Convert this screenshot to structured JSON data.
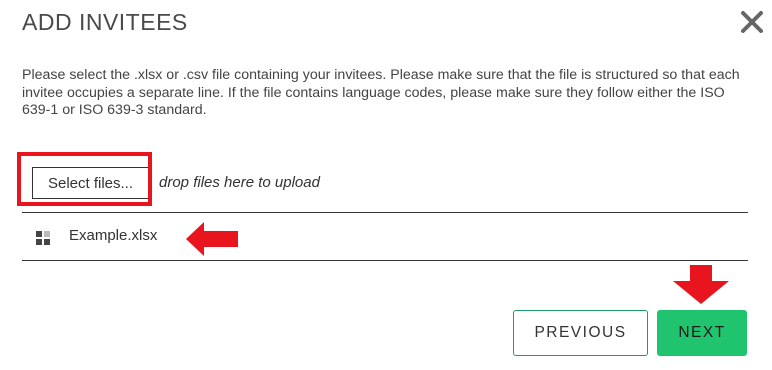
{
  "dialog": {
    "title": "ADD INVITEES",
    "close_icon": "close-icon",
    "description": "Please select the .xlsx or .csv file containing your invitees. Please make sure that the file is structured so that each invitee occupies a separate line. If the file contains language codes, please make sure they follow either the ISO 639-1 or ISO 639-3 standard."
  },
  "upload": {
    "select_label": "Select files...",
    "drop_hint": "drop files here to upload"
  },
  "files": [
    {
      "name": "Example.xlsx",
      "icon": "file-grid-icon"
    }
  ],
  "footer": {
    "previous_label": "PREVIOUS",
    "next_label": "NEXT"
  },
  "colors": {
    "accent_green": "#20c46f",
    "highlight_red": "#e8141e"
  }
}
